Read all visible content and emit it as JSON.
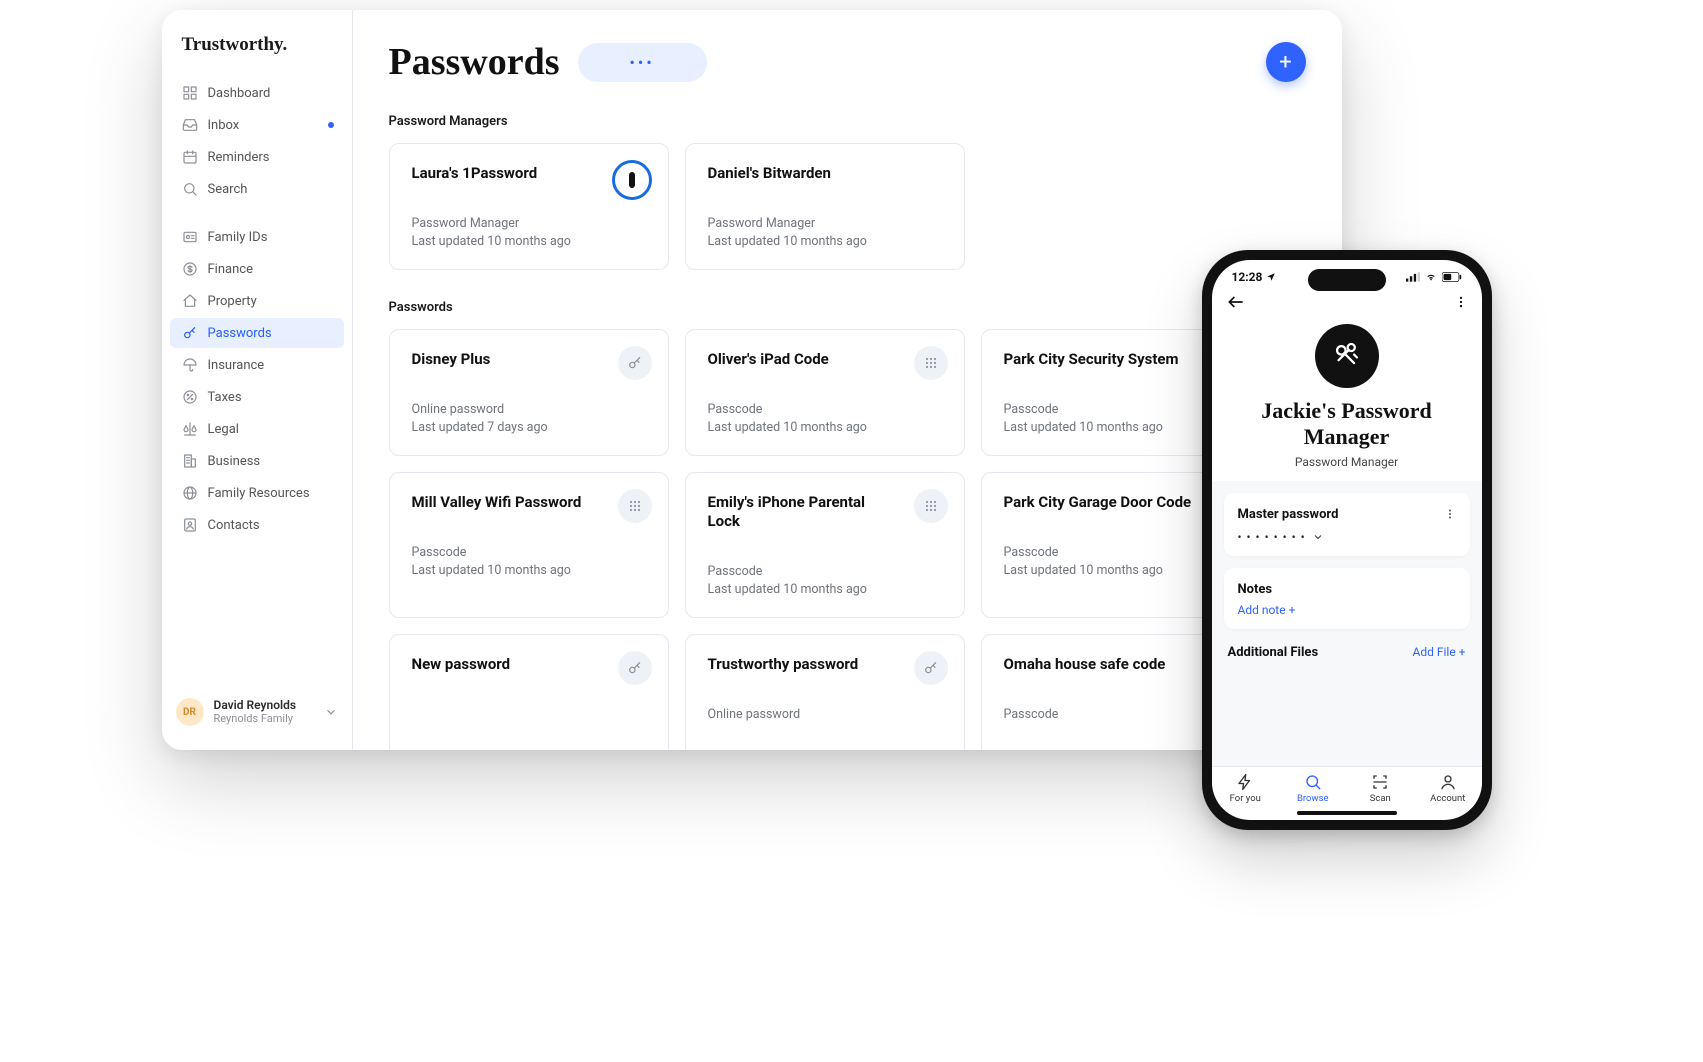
{
  "brand": "Trustworthy.",
  "sidebar": {
    "primary": [
      {
        "label": "Dashboard",
        "icon": "grid-icon"
      },
      {
        "label": "Inbox",
        "icon": "inbox-icon",
        "unread": true
      },
      {
        "label": "Reminders",
        "icon": "calendar-icon"
      },
      {
        "label": "Search",
        "icon": "search-icon"
      }
    ],
    "secondary": [
      {
        "label": "Family IDs",
        "icon": "id-icon"
      },
      {
        "label": "Finance",
        "icon": "dollar-icon"
      },
      {
        "label": "Property",
        "icon": "home-icon"
      },
      {
        "label": "Passwords",
        "icon": "key-icon",
        "active": true
      },
      {
        "label": "Insurance",
        "icon": "umbrella-icon"
      },
      {
        "label": "Taxes",
        "icon": "percent-icon"
      },
      {
        "label": "Legal",
        "icon": "scale-icon"
      },
      {
        "label": "Business",
        "icon": "building-icon"
      },
      {
        "label": "Family Resources",
        "icon": "globe-icon"
      },
      {
        "label": "Contacts",
        "icon": "contacts-icon"
      }
    ],
    "user": {
      "initials": "DR",
      "name": "David Reynolds",
      "family": "Reynolds Family"
    }
  },
  "page": {
    "title": "Passwords",
    "menu_glyph": "•••",
    "add_glyph": "+"
  },
  "sections": [
    {
      "label": "Password Managers",
      "cards": [
        {
          "title": "Laura's 1Password",
          "type": "Password Manager",
          "updated": "Last updated 10 months ago",
          "badge": "onepassword"
        },
        {
          "title": "Daniel's Bitwarden",
          "type": "Password Manager",
          "updated": "Last updated 10 months ago"
        }
      ]
    },
    {
      "label": "Passwords",
      "cards": [
        {
          "title": "Disney Plus",
          "type": "Online password",
          "updated": "Last updated 7 days ago",
          "badge": "key"
        },
        {
          "title": "Oliver's iPad Code",
          "type": "Passcode",
          "updated": "Last updated 10 months ago",
          "badge": "grid"
        },
        {
          "title": "Park City Security System",
          "type": "Passcode",
          "updated": "Last updated 10 months ago"
        },
        {
          "title": "Mill Valley Wifi Password",
          "type": "Passcode",
          "updated": "Last updated 10 months ago",
          "badge": "grid"
        },
        {
          "title": "Emily's iPhone Parental Lock",
          "type": "Passcode",
          "updated": "Last updated 10 months ago",
          "badge": "grid"
        },
        {
          "title": "Park City Garage Door Code",
          "type": "Passcode",
          "updated": "Last updated 10 months ago"
        },
        {
          "title": "New password",
          "type": "",
          "updated": "",
          "badge": "key"
        },
        {
          "title": "Trustworthy password",
          "type": "Online password",
          "updated": "",
          "badge": "key"
        },
        {
          "title": "Omaha house safe code",
          "type": "Passcode",
          "updated": ""
        }
      ]
    }
  ],
  "phone": {
    "time": "12:28",
    "title": "Jackie's Password Manager",
    "subtitle": "Password Manager",
    "master_label": "Master password",
    "mask": "• • • • • • • •",
    "notes_label": "Notes",
    "add_note": "Add note +",
    "files_label": "Additional Files",
    "add_file": "Add File +",
    "tabs": [
      {
        "label": "For you",
        "icon": "spark-icon"
      },
      {
        "label": "Browse",
        "icon": "search-icon",
        "active": true
      },
      {
        "label": "Scan",
        "icon": "scan-icon"
      },
      {
        "label": "Account",
        "icon": "user-icon"
      }
    ]
  }
}
